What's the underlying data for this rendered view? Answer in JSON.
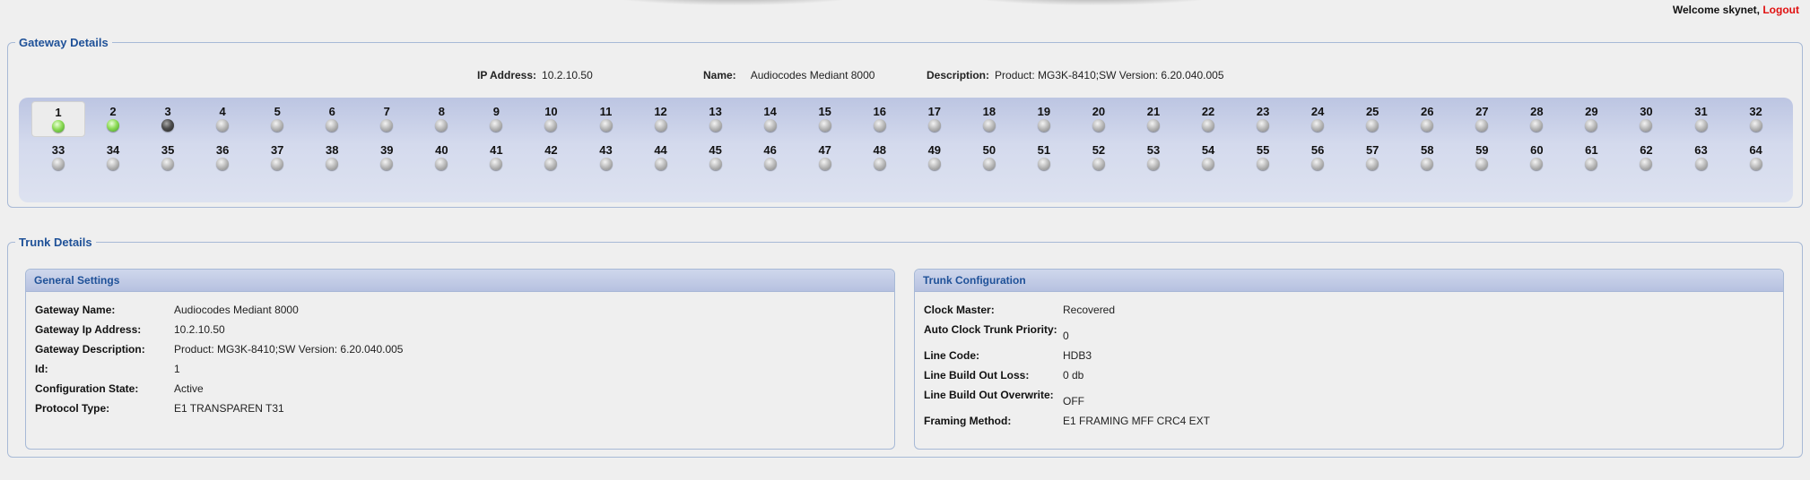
{
  "header": {
    "welcome_text": "Welcome skynet,",
    "logout_label": "Logout",
    "logout_color": "#e01010"
  },
  "gateway": {
    "legend": "Gateway Details",
    "ip_label": "IP Address:",
    "ip_value": "10.2.10.50",
    "name_label": "Name:",
    "name_value": "Audiocodes Mediant 8000",
    "desc_label": "Description:",
    "desc_value": "Product: MG3K-8410;SW Version: 6.20.040.005",
    "selected_port": "1",
    "ports": [
      {
        "num": "1",
        "status": "green"
      },
      {
        "num": "2",
        "status": "green"
      },
      {
        "num": "3",
        "status": "dark"
      },
      {
        "num": "4",
        "status": "gray"
      },
      {
        "num": "5",
        "status": "gray"
      },
      {
        "num": "6",
        "status": "gray"
      },
      {
        "num": "7",
        "status": "gray"
      },
      {
        "num": "8",
        "status": "gray"
      },
      {
        "num": "9",
        "status": "gray"
      },
      {
        "num": "10",
        "status": "gray"
      },
      {
        "num": "11",
        "status": "gray"
      },
      {
        "num": "12",
        "status": "gray"
      },
      {
        "num": "13",
        "status": "gray"
      },
      {
        "num": "14",
        "status": "gray"
      },
      {
        "num": "15",
        "status": "gray"
      },
      {
        "num": "16",
        "status": "gray"
      },
      {
        "num": "17",
        "status": "gray"
      },
      {
        "num": "18",
        "status": "gray"
      },
      {
        "num": "19",
        "status": "gray"
      },
      {
        "num": "20",
        "status": "gray"
      },
      {
        "num": "21",
        "status": "gray"
      },
      {
        "num": "22",
        "status": "gray"
      },
      {
        "num": "23",
        "status": "gray"
      },
      {
        "num": "24",
        "status": "gray"
      },
      {
        "num": "25",
        "status": "gray"
      },
      {
        "num": "26",
        "status": "gray"
      },
      {
        "num": "27",
        "status": "gray"
      },
      {
        "num": "28",
        "status": "gray"
      },
      {
        "num": "29",
        "status": "gray"
      },
      {
        "num": "30",
        "status": "gray"
      },
      {
        "num": "31",
        "status": "gray"
      },
      {
        "num": "32",
        "status": "gray"
      },
      {
        "num": "33",
        "status": "gray"
      },
      {
        "num": "34",
        "status": "gray"
      },
      {
        "num": "35",
        "status": "gray"
      },
      {
        "num": "36",
        "status": "gray"
      },
      {
        "num": "37",
        "status": "gray"
      },
      {
        "num": "38",
        "status": "gray"
      },
      {
        "num": "39",
        "status": "gray"
      },
      {
        "num": "40",
        "status": "gray"
      },
      {
        "num": "41",
        "status": "gray"
      },
      {
        "num": "42",
        "status": "gray"
      },
      {
        "num": "43",
        "status": "gray"
      },
      {
        "num": "44",
        "status": "gray"
      },
      {
        "num": "45",
        "status": "gray"
      },
      {
        "num": "46",
        "status": "gray"
      },
      {
        "num": "47",
        "status": "gray"
      },
      {
        "num": "48",
        "status": "gray"
      },
      {
        "num": "49",
        "status": "gray"
      },
      {
        "num": "50",
        "status": "gray"
      },
      {
        "num": "51",
        "status": "gray"
      },
      {
        "num": "52",
        "status": "gray"
      },
      {
        "num": "53",
        "status": "gray"
      },
      {
        "num": "54",
        "status": "gray"
      },
      {
        "num": "55",
        "status": "gray"
      },
      {
        "num": "56",
        "status": "gray"
      },
      {
        "num": "57",
        "status": "gray"
      },
      {
        "num": "58",
        "status": "gray"
      },
      {
        "num": "59",
        "status": "gray"
      },
      {
        "num": "60",
        "status": "gray"
      },
      {
        "num": "61",
        "status": "gray"
      },
      {
        "num": "62",
        "status": "gray"
      },
      {
        "num": "63",
        "status": "gray"
      },
      {
        "num": "64",
        "status": "gray"
      }
    ]
  },
  "trunk": {
    "legend": "Trunk Details",
    "general": {
      "title": "General Settings",
      "rows": [
        {
          "label": "Gateway Name:",
          "value": "Audiocodes Mediant 8000"
        },
        {
          "label": "Gateway Ip Address:",
          "value": "10.2.10.50"
        },
        {
          "label": "Gateway Description:",
          "value": "Product: MG3K-8410;SW Version: 6.20.040.005"
        },
        {
          "label": "Id:",
          "value": "1"
        },
        {
          "label": "Configuration State:",
          "value": "Active"
        },
        {
          "label": "Protocol Type:",
          "value": "E1 TRANSPAREN T31"
        }
      ]
    },
    "config": {
      "title": "Trunk Configuration",
      "rows": [
        {
          "label": "Clock Master:",
          "value": "Recovered"
        },
        {
          "label": "Auto Clock Trunk Priority:",
          "value": "0"
        },
        {
          "label": "Line Code:",
          "value": "HDB3"
        },
        {
          "label": "Line Build Out Loss:",
          "value": "0 db"
        },
        {
          "label": "Line Build Out Overwrite:",
          "value": "OFF"
        },
        {
          "label": "Framing Method:",
          "value": "E1 FRAMING MFF CRC4 EXT"
        }
      ]
    }
  },
  "colors": {
    "legend": "#1f5198",
    "led_green": "#8fdc58",
    "panel_header": "#b6c1e0"
  }
}
